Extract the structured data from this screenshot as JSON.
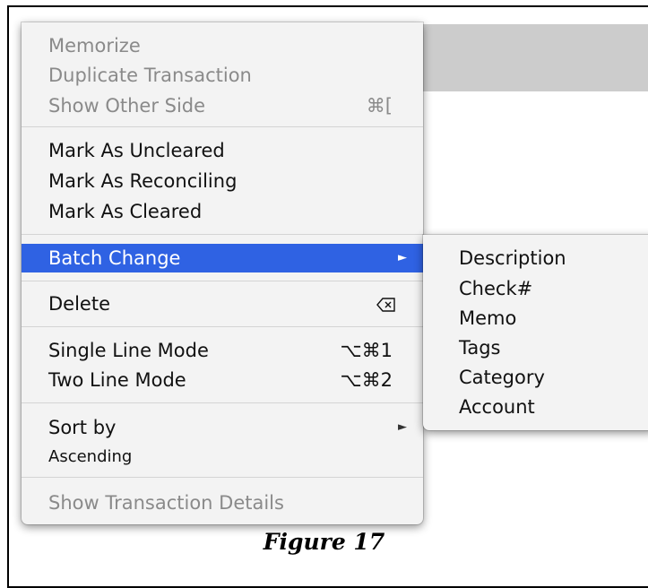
{
  "menu": {
    "items": [
      {
        "label": "Memorize",
        "shortcut": "",
        "disabled": true
      },
      {
        "label": "Duplicate Transaction",
        "shortcut": "",
        "disabled": true
      },
      {
        "label": "Show Other Side",
        "shortcut": "⌘[",
        "disabled": true
      },
      {
        "label": "Mark As Uncleared",
        "shortcut": ""
      },
      {
        "label": "Mark As Reconciling",
        "shortcut": ""
      },
      {
        "label": "Mark As Cleared",
        "shortcut": ""
      },
      {
        "label": "Batch Change",
        "shortcut": "",
        "highlighted": true
      },
      {
        "label": "Delete",
        "shortcut": ""
      },
      {
        "label": "Single Line Mode",
        "shortcut": "⌥⌘1"
      },
      {
        "label": "Two Line Mode",
        "shortcut": "⌥⌘2"
      },
      {
        "label": "Sort by",
        "shortcut": ""
      },
      {
        "label": "Ascending",
        "shortcut": ""
      },
      {
        "label": "Show Transaction Details",
        "shortcut": "",
        "disabled": true
      }
    ],
    "arrow_glyph": "►",
    "delete_icon": "delete-key-icon"
  },
  "submenu": {
    "items": [
      "Description",
      "Check#",
      "Memo",
      "Tags",
      "Category",
      "Account"
    ]
  },
  "caption": "Figure 17",
  "colors": {
    "highlight": "#2f62e3",
    "menu_bg": "#f3f3f3",
    "disabled_text": "#8a8a8a",
    "header_band": "#cccccc"
  }
}
